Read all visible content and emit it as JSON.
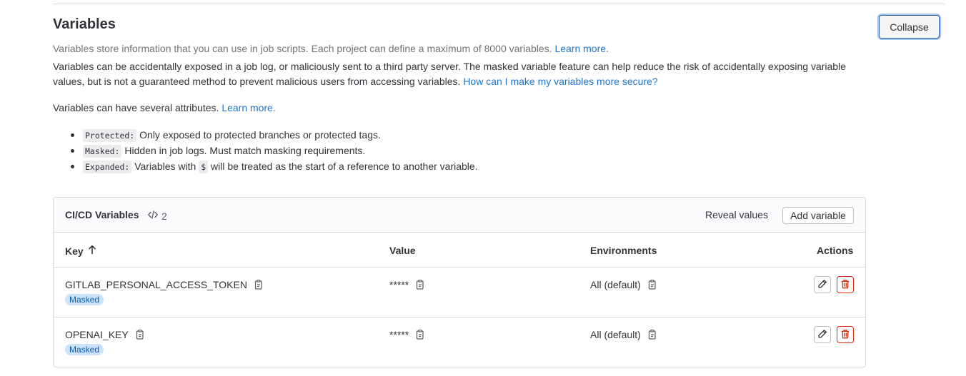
{
  "section": {
    "title": "Variables",
    "collapse_label": "Collapse",
    "subtitle": "Variables store information that you can use in job scripts. Each project can define a maximum of 8000 variables.",
    "subtitle_link": "Learn more.",
    "warning_text": "Variables can be accidentally exposed in a job log, or maliciously sent to a third party server. The masked variable feature can help reduce the risk of accidentally exposing variable values, but is not a guaranteed method to prevent malicious users from accessing variables.",
    "warning_link": "How can I make my variables more secure?",
    "attributes_text": "Variables can have several attributes.",
    "attributes_link": "Learn more.",
    "attributes": [
      {
        "code": "Protected:",
        "text": "Only exposed to protected branches or protected tags."
      },
      {
        "code": "Masked:",
        "text": "Hidden in job logs. Must match masking requirements."
      },
      {
        "code": "Expanded:",
        "text_before": "Variables with",
        "inline_code": "$",
        "text_after": "will be treated as the start of a reference to another variable."
      }
    ]
  },
  "card": {
    "title": "CI/CD Variables",
    "count": "2",
    "reveal_label": "Reveal values",
    "add_label": "Add variable",
    "columns": {
      "key": "Key",
      "sort_indicator": "↑",
      "value": "Value",
      "environments": "Environments",
      "actions": "Actions"
    },
    "rows": [
      {
        "key": "GITLAB_PERSONAL_ACCESS_TOKEN",
        "badge": "Masked",
        "value": "*****",
        "environment": "All (default)"
      },
      {
        "key": "OPENAI_KEY",
        "badge": "Masked",
        "value": "*****",
        "environment": "All (default)"
      }
    ]
  },
  "icons": {
    "copy": "copy-icon",
    "edit": "pencil-icon",
    "delete": "trash-icon",
    "code": "code-icon",
    "sort": "arrow-up-icon"
  },
  "colors": {
    "link": "#1f75cb",
    "badge_bg": "#cbe2f9",
    "badge_text": "#0b5cad",
    "danger": "#dd2b0e"
  }
}
